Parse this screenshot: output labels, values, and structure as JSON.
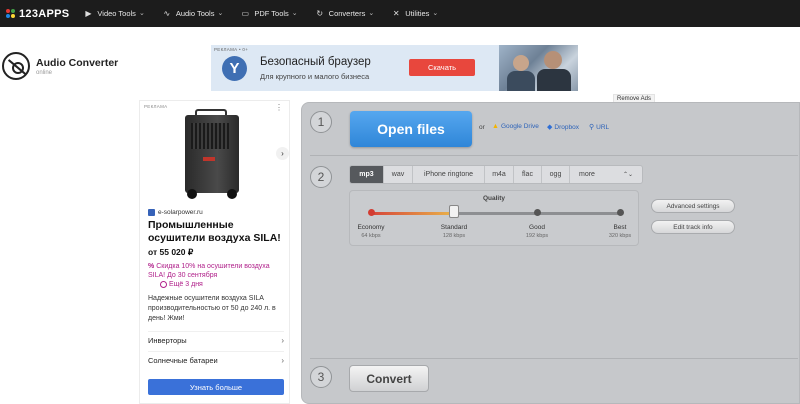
{
  "nav": {
    "logo": "123APPS",
    "logo_colors": [
      "#e53935",
      "#43a047",
      "#1e88e5",
      "#fdd835"
    ],
    "items": [
      {
        "label": "Video Tools",
        "icon": "video-icon",
        "glyph": "▶"
      },
      {
        "label": "Audio Tools",
        "icon": "audio-waves-icon",
        "glyph": "∿"
      },
      {
        "label": "PDF Tools",
        "icon": "pdf-icon",
        "glyph": "▭"
      },
      {
        "label": "Converters",
        "icon": "converter-icon",
        "glyph": "↻"
      },
      {
        "label": "Utilities",
        "icon": "utilities-icon",
        "glyph": "✕"
      }
    ]
  },
  "brand": {
    "title": "Audio Converter",
    "subtitle": "online"
  },
  "banner": {
    "label": "РЕКЛАМА • 0+",
    "logo": "Y",
    "headline": "Безопасный браузер",
    "sub": "Для крупного и малого бизнеса",
    "button": "Скачать"
  },
  "remove_ads": "Remove Ads",
  "side_ad": {
    "label": "РЕКЛАМА",
    "domain": "e-solarpower.ru",
    "title": "Промышленные осушители воздуха SILA!",
    "price": "от 55 020 ₽",
    "promo": "Скидка 10% на осушители воздуха SILA! До 30 сентября",
    "days": "Ещё 3 дня",
    "desc": "Надежные осушители воздуха SILA производительностью от 50 до 240 л. в день! Жми!",
    "links": [
      "Инверторы",
      "Солнечные батареи"
    ],
    "cta": "Узнать больше"
  },
  "converter": {
    "steps": [
      "1",
      "2",
      "3"
    ],
    "open_files": "Open files",
    "or": "or",
    "sources": [
      {
        "label": "Google Drive",
        "icon": "google-drive-icon",
        "glyph": "▲"
      },
      {
        "label": "Dropbox",
        "icon": "dropbox-icon",
        "glyph": "◆"
      },
      {
        "label": "URL",
        "icon": "link-icon",
        "glyph": "🔗"
      }
    ],
    "formats": [
      "mp3",
      "wav",
      "iPhone ringtone",
      "m4a",
      "flac",
      "ogg",
      "more"
    ],
    "active_format": "mp3",
    "quality": {
      "title": "Quality",
      "selected": "Standard",
      "levels": [
        {
          "label": "Economy",
          "rate": "64 kbps"
        },
        {
          "label": "Standard",
          "rate": "128 kbps"
        },
        {
          "label": "Good",
          "rate": "192 kbps"
        },
        {
          "label": "Best",
          "rate": "320 kbps"
        }
      ]
    },
    "advanced_settings": "Advanced settings",
    "edit_track_info": "Edit track info",
    "convert": "Convert"
  }
}
